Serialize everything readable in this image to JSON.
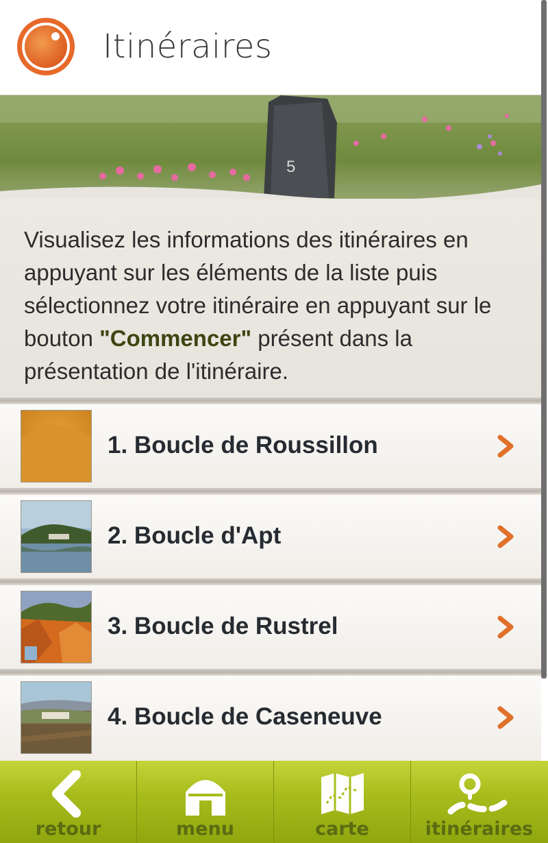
{
  "header": {
    "title": "Itinéraires"
  },
  "intro": {
    "text_before": "Visualisez les informations des itinéraires en appuyant sur les éléments de la liste puis sélectionnez votre itinéraire en appuyant sur le bouton ",
    "highlight": "\"Commencer\"",
    "text_after": " présent dans la présentation de l'itinéraire."
  },
  "routes": [
    {
      "label": "1. Boucle de Roussillon"
    },
    {
      "label": "2. Boucle d'Apt"
    },
    {
      "label": "3. Boucle de Rustrel"
    },
    {
      "label": "4. Boucle de Caseneuve"
    }
  ],
  "tabbar": {
    "back_label": "retour",
    "menu_label": "menu",
    "map_label": "carte",
    "routes_label": "itinéraires"
  },
  "colors": {
    "accent": "#e0702a",
    "tabbar": "#a8bd1c",
    "highlight": "#3d4511"
  }
}
